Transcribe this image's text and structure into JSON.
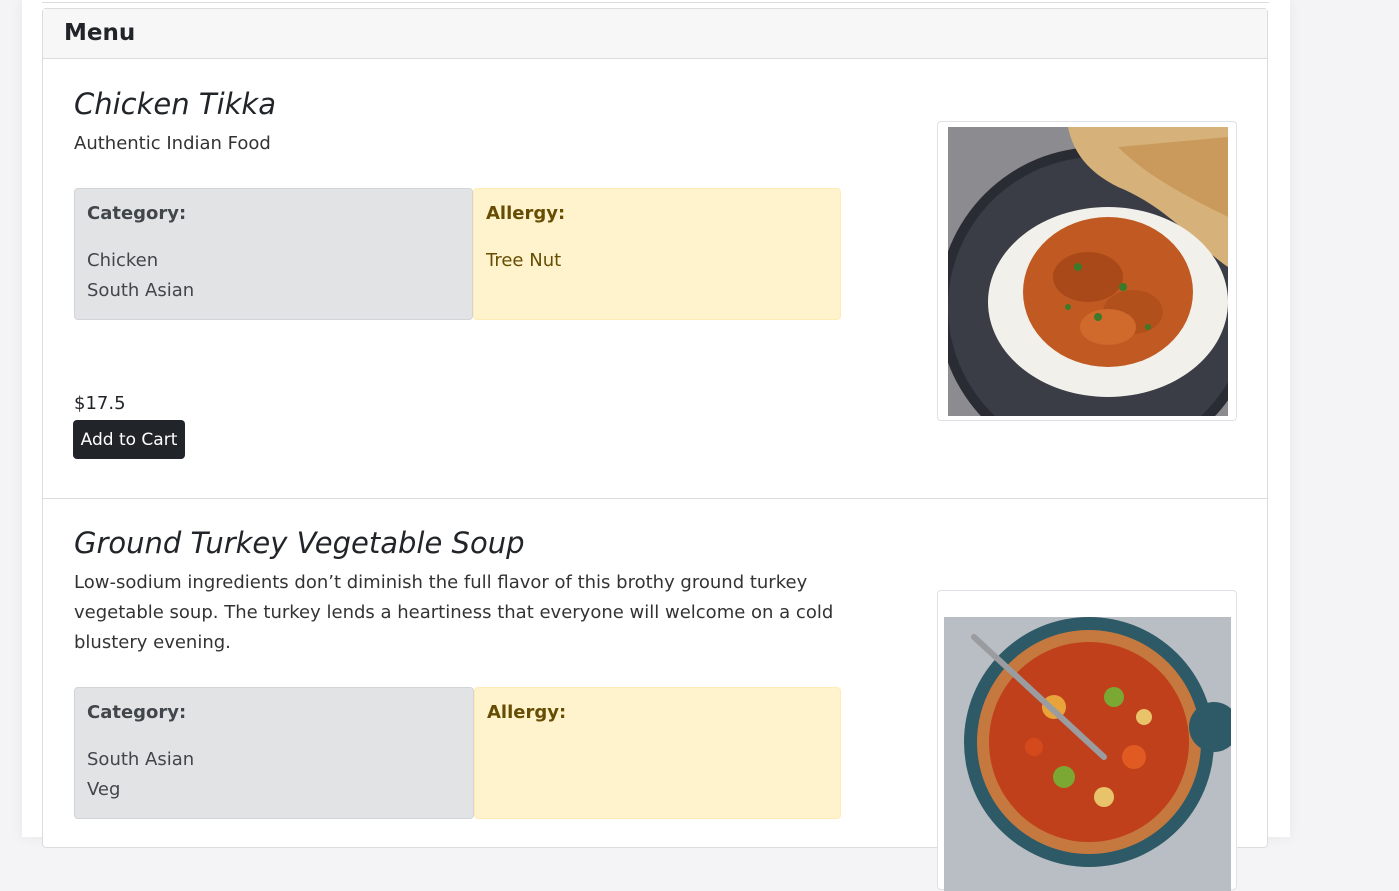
{
  "menu": {
    "title": "Menu"
  },
  "items": [
    {
      "name": "Chicken Tikka",
      "description": "Authentic Indian Food",
      "category_label": "Category:",
      "categories": [
        "Chicken",
        "South Asian"
      ],
      "allergy_label": "Allergy:",
      "allergies": [
        "Tree Nut"
      ],
      "price": "$17.5",
      "cart_label": "Add to Cart"
    },
    {
      "name": "Ground Turkey Vegetable Soup",
      "description": "Low-sodium ingredients don’t diminish the full flavor of this brothy ground turkey vegetable soup. The turkey lends a heartiness that everyone will welcome on a cold blustery evening.",
      "category_label": "Category:",
      "categories": [
        "South Asian",
        "Veg"
      ],
      "allergy_label": "Allergy:",
      "allergies": []
    }
  ],
  "colors": {
    "category_bg": "#e2e3e5",
    "allergy_bg": "#fff3cd",
    "button_bg": "#212529"
  }
}
